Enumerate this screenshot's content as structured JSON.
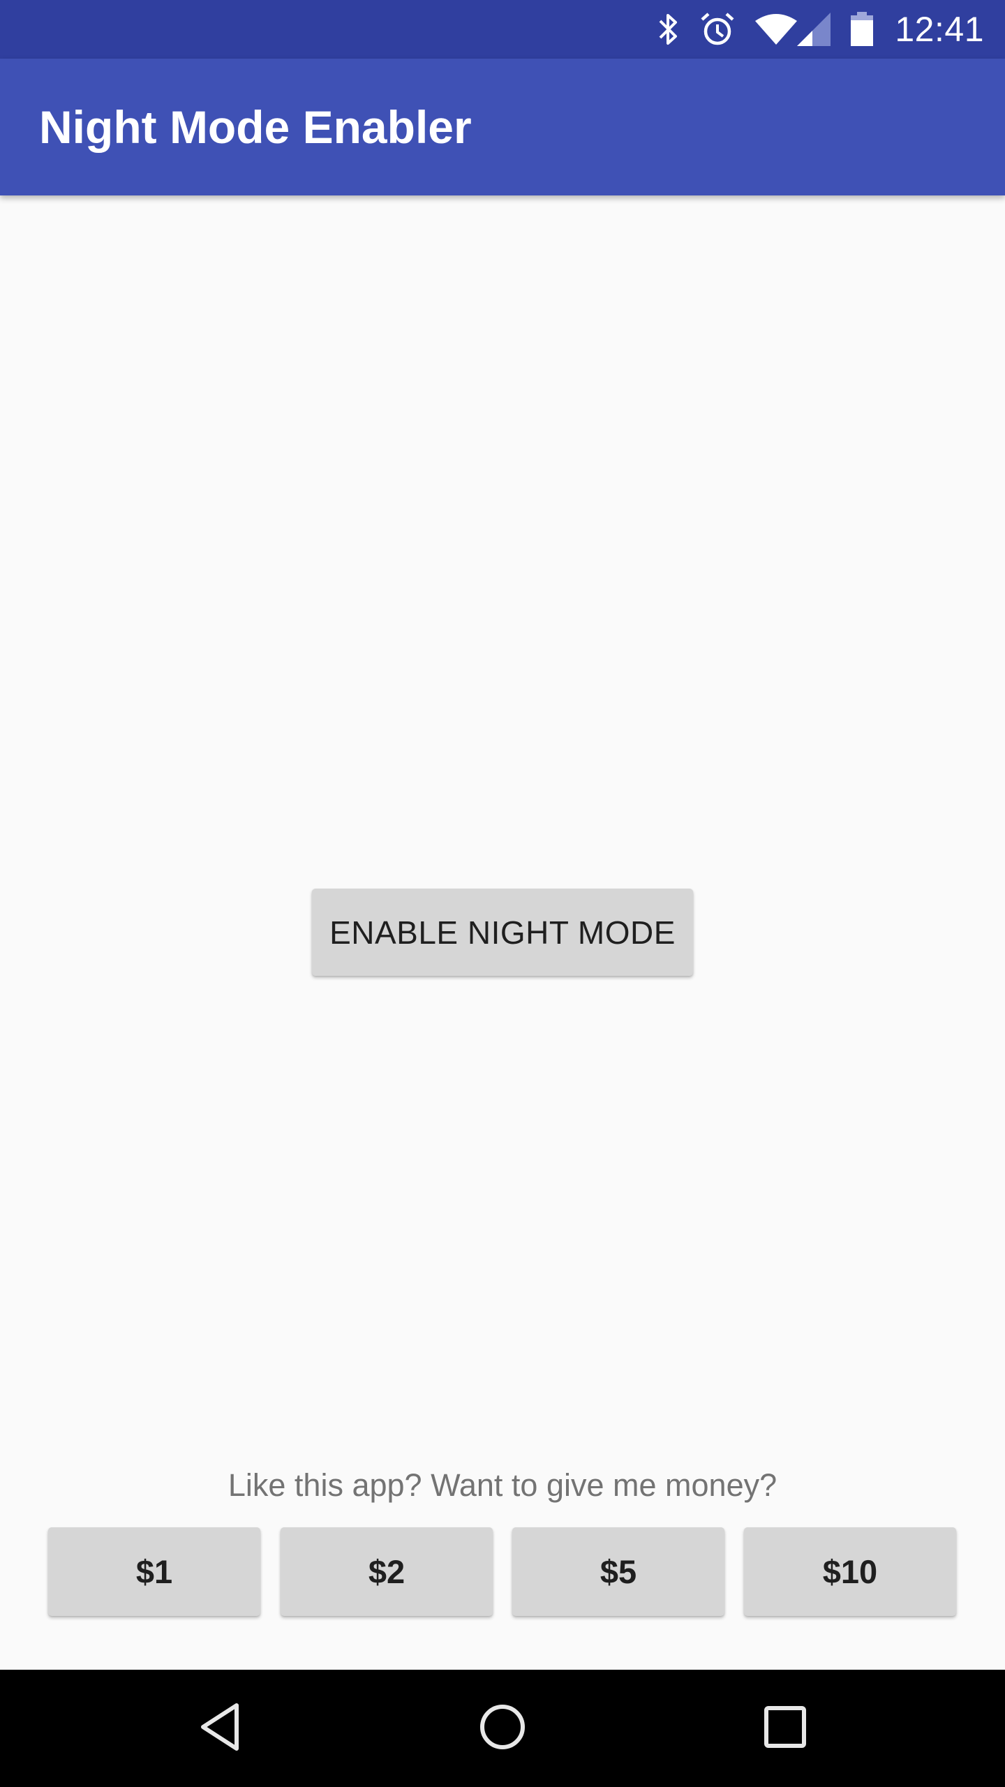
{
  "status_bar": {
    "time": "12:41",
    "icons": [
      "bluetooth-icon",
      "alarm-icon",
      "wifi-icon",
      "cell-signal-icon",
      "battery-icon"
    ],
    "background_color": "#303f9f"
  },
  "app_bar": {
    "title": "Night Mode Enabler",
    "background_color": "#3f51b5"
  },
  "main": {
    "enable_button_label": "ENABLE NIGHT MODE",
    "donate_prompt": "Like this app? Want to give me money?",
    "donate_buttons": [
      {
        "label": "$1"
      },
      {
        "label": "$2"
      },
      {
        "label": "$5"
      },
      {
        "label": "$10"
      }
    ]
  },
  "nav_bar": {
    "buttons": [
      "back-icon",
      "home-icon",
      "recents-icon"
    ]
  }
}
